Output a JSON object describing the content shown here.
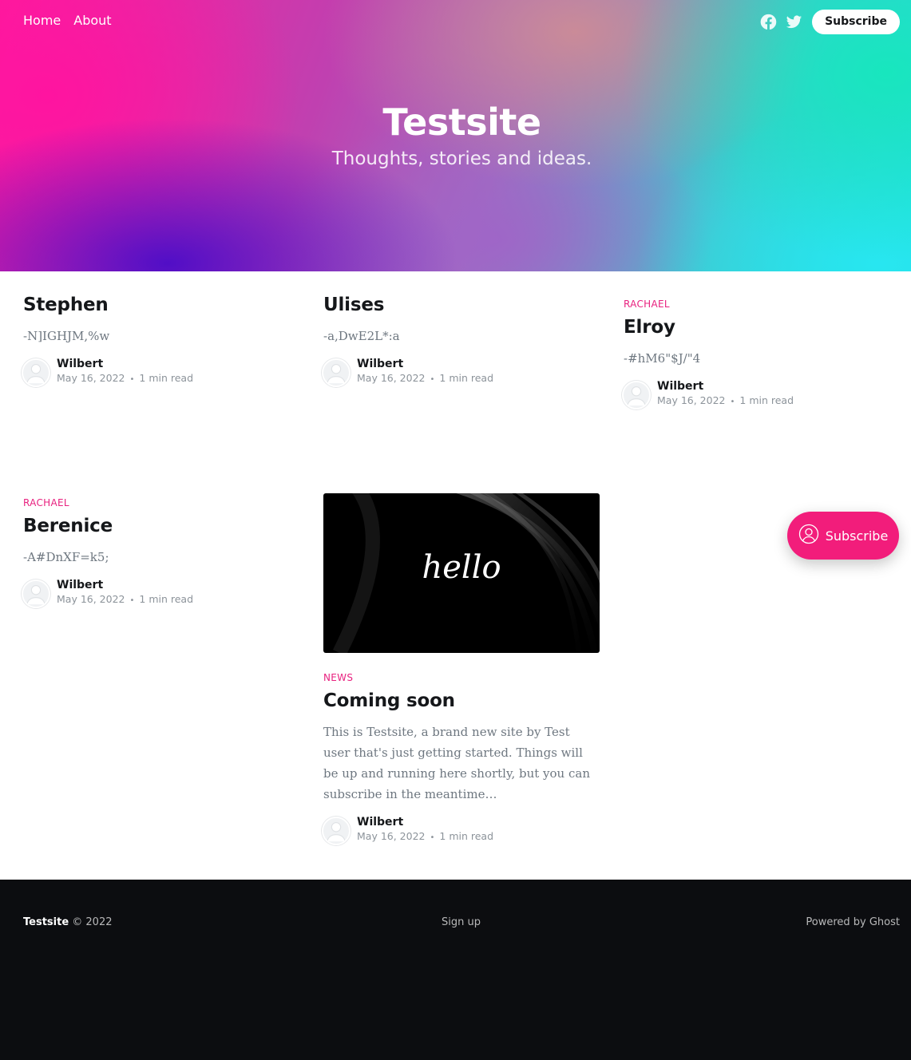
{
  "nav": {
    "home": "Home",
    "about": "About"
  },
  "header": {
    "subscribe_label": "Subscribe",
    "social": [
      "facebook-icon",
      "twitter-icon"
    ]
  },
  "site": {
    "title": "Testsite",
    "description": "Thoughts, stories and ideas."
  },
  "posts": [
    {
      "tag": "",
      "title": "Stephen",
      "excerpt": "-N]IGHJM,%w",
      "author": "Wilbert",
      "date": "May 16, 2022",
      "read": "1 min read"
    },
    {
      "tag": "",
      "title": "Ulises",
      "excerpt": "-a,DwE2L*:a",
      "author": "Wilbert",
      "date": "May 16, 2022",
      "read": "1 min read"
    },
    {
      "tag": "RACHAEL",
      "title": "Elroy",
      "excerpt": "-#hM6\"$J/\"4",
      "author": "Wilbert",
      "date": "May 16, 2022",
      "read": "1 min read"
    },
    {
      "tag": "RACHAEL",
      "title": "Berenice",
      "excerpt": "-A#DnXF=k5;",
      "author": "Wilbert",
      "date": "May 16, 2022",
      "read": "1 min read"
    },
    {
      "tag": "NEWS",
      "title": "Coming soon",
      "image_text": "hello",
      "excerpt": "This is Testsite, a brand new site by Test user that's just getting started. Things will be up and running here shortly, but you can subscribe in the meantime…",
      "author": "Wilbert",
      "date": "May 16, 2022",
      "read": "1 min read"
    }
  ],
  "float_subscribe": "Subscribe",
  "footer": {
    "site": "Testsite",
    "copyright": "© 2022",
    "signup": "Sign up",
    "powered": "Powered by Ghost"
  },
  "colors": {
    "accent": "#e8217f",
    "footer_bg": "#0c0d10"
  }
}
